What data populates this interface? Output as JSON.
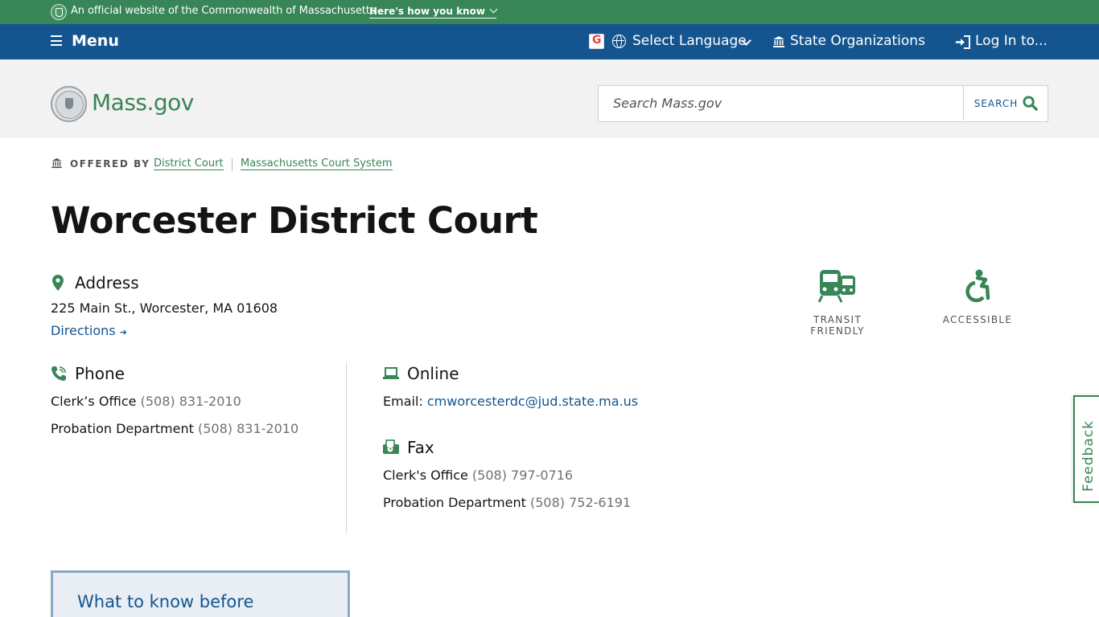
{
  "topbar": {
    "official_text": "An official website of the Commonwealth of Massachusetts",
    "how_you_know": "Here's how you know"
  },
  "navbar": {
    "menu_label": "Menu",
    "language_label": "Select Language",
    "organizations_label": "State Organizations",
    "login_label": "Log In to..."
  },
  "header": {
    "logo_text": "Mass.gov",
    "search_placeholder": "Search Mass.gov",
    "search_button": "SEARCH"
  },
  "offered_by": {
    "label": "OFFERED BY",
    "links": [
      "District Court",
      "Massachusetts Court System"
    ]
  },
  "page": {
    "title": "Worcester District Court"
  },
  "address": {
    "title": "Address",
    "value": "225 Main St., Worcester, MA 01608",
    "directions_label": "Directions"
  },
  "amenities": [
    {
      "label": "TRANSIT FRIENDLY",
      "icon": "transit-icon"
    },
    {
      "label": "ACCESSIBLE",
      "icon": "accessible-icon"
    }
  ],
  "phone": {
    "title": "Phone",
    "entries": [
      {
        "label": "Clerk’s Office",
        "number": "(508) 831-2010"
      },
      {
        "label": "Probation Department",
        "number": "(508) 831-2010"
      }
    ]
  },
  "online": {
    "title": "Online",
    "email_label": "Email:",
    "email": "cmworcesterdc@jud.state.ma.us"
  },
  "fax": {
    "title": "Fax",
    "entries": [
      {
        "label": "Clerk's Office",
        "number": "(508) 797-0716"
      },
      {
        "label": "Probation Department",
        "number": "(508) 752-6191"
      }
    ]
  },
  "feedback_label": "Feedback",
  "know_box": {
    "title": "What to know before"
  },
  "colors": {
    "brand_green": "#388557",
    "nav_blue": "#14558f",
    "header_gray": "#f2f2f2"
  }
}
